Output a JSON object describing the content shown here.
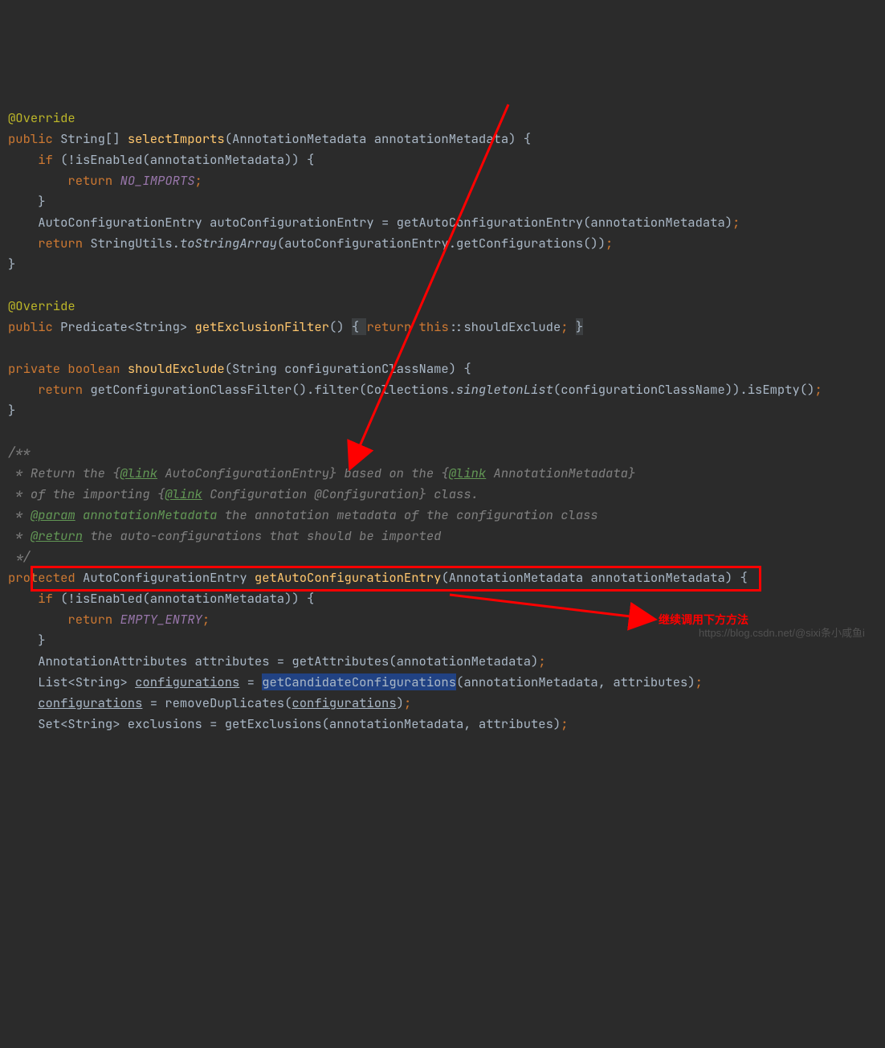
{
  "code": {
    "l1_ann": "@Override",
    "l2_kw": "public ",
    "l2_type": "String[] ",
    "l2_mname": "selectImports",
    "l2_rest": "(AnnotationMetadata annotationMetadata) {",
    "l3_kw": "    if ",
    "l3_rest": "(!isEnabled(annotationMetadata)) {",
    "l4_kw": "        return ",
    "l4_val": "NO_IMPORTS",
    "l4_semi": ";",
    "l5": "    }",
    "l6_a": "    AutoConfigurationEntry autoConfigurationEntry = getAutoConfigurationEntry(annotationMetadata)",
    "l6_s": ";",
    "l7_kw": "    return ",
    "l7_a": "StringUtils.",
    "l7_m": "toStringArray",
    "l7_b": "(autoConfigurationEntry.getConfigurations())",
    "l7_s": ";",
    "l8": "}",
    "l10_ann": "@Override",
    "l11_kw": "public ",
    "l11_type": "Predicate<String> ",
    "l11_mname": "getExclusionFilter",
    "l11_a": "() ",
    "l11_fold1": "{ ",
    "l11_kw2": "return ",
    "l11_kw3": "this",
    "l11_b": "::shouldExclude",
    "l11_s": "; ",
    "l11_fold2": "}",
    "l13_kw": "private boolean ",
    "l13_mname": "shouldExclude",
    "l13_rest": "(String configurationClassName) {",
    "l14_kw": "    return ",
    "l14_a": "getConfigurationClassFilter().filter(Collections.",
    "l14_m": "singletonList",
    "l14_b": "(configurationClassName)).isEmpty()",
    "l14_s": ";",
    "l15": "}",
    "l17": "/**",
    "l18_a": " * Return the {",
    "l18_tag": "@link",
    "l18_b": " AutoConfigurationEntry} based on the {",
    "l18_tag2": "@link",
    "l18_c": " AnnotationMetadata}",
    "l19_a": " * of the importing {",
    "l19_tag": "@link",
    "l19_b": " Configuration @Configuration} class.",
    "l20_a": " * ",
    "l20_tag": "@param",
    "l20_b": " annotationMetadata",
    "l20_c": " the annotation metadata of the configuration class",
    "l21_a": " * ",
    "l21_tag": "@return",
    "l21_b": " the auto-configurations that should be imported",
    "l22": " */",
    "l23_kw": "protected ",
    "l23_type": "AutoConfigurationEntry ",
    "l23_mname": "getAutoConfigurationEntry",
    "l23_rest": "(AnnotationMetadata annotationMetadata) {",
    "l24_kw": "    if ",
    "l24_rest": "(!isEnabled(annotationMetadata)) {",
    "l25_kw": "        return ",
    "l25_val": "EMPTY_ENTRY",
    "l25_s": ";",
    "l26": "    }",
    "l27_a": "    AnnotationAttributes attributes = getAttributes(annotationMetadata)",
    "l27_s": ";",
    "l28_a": "    List<String> ",
    "l28_u1": "configurations",
    "l28_b": " = ",
    "l28_sel": "getCandidateConfigurations",
    "l28_c": "(annotationMetadata, attributes)",
    "l28_s": ";",
    "l29_a": "    ",
    "l29_u1": "configurations",
    "l29_b": " = removeDuplicates(",
    "l29_u2": "configurations",
    "l29_c": ")",
    "l29_s": ";",
    "l30_a": "    Set<String> exclusions = getExclusions(annotationMetadata, attributes)",
    "l30_s": ";"
  },
  "annotations": {
    "red_label": "继续调用下方方法"
  },
  "watermark": {
    "text": "https://blog.csdn.net/@sixi条小咸鱼i"
  }
}
